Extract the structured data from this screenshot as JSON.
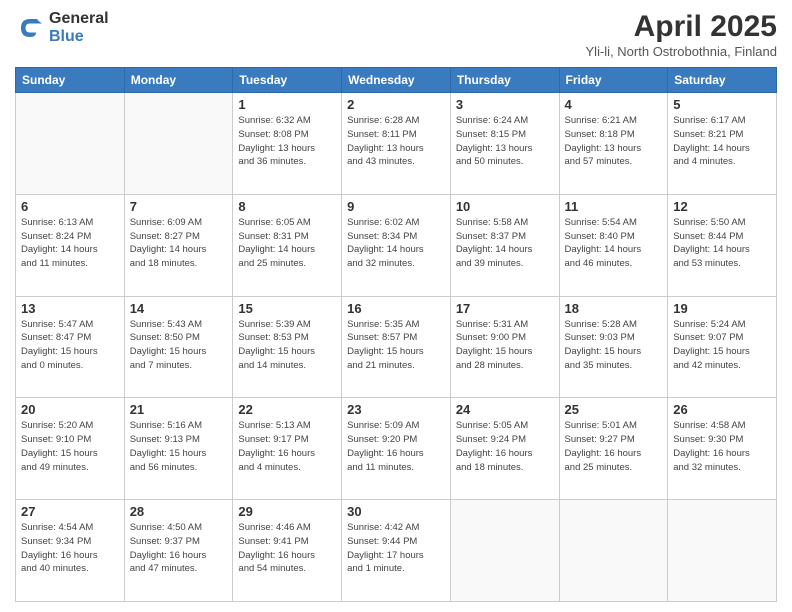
{
  "header": {
    "logo_general": "General",
    "logo_blue": "Blue",
    "title": "April 2025",
    "subtitle": "Yli-li, North Ostrobothnia, Finland"
  },
  "days_of_week": [
    "Sunday",
    "Monday",
    "Tuesday",
    "Wednesday",
    "Thursday",
    "Friday",
    "Saturday"
  ],
  "weeks": [
    [
      {
        "day": "",
        "info": ""
      },
      {
        "day": "",
        "info": ""
      },
      {
        "day": "1",
        "info": "Sunrise: 6:32 AM\nSunset: 8:08 PM\nDaylight: 13 hours\nand 36 minutes."
      },
      {
        "day": "2",
        "info": "Sunrise: 6:28 AM\nSunset: 8:11 PM\nDaylight: 13 hours\nand 43 minutes."
      },
      {
        "day": "3",
        "info": "Sunrise: 6:24 AM\nSunset: 8:15 PM\nDaylight: 13 hours\nand 50 minutes."
      },
      {
        "day": "4",
        "info": "Sunrise: 6:21 AM\nSunset: 8:18 PM\nDaylight: 13 hours\nand 57 minutes."
      },
      {
        "day": "5",
        "info": "Sunrise: 6:17 AM\nSunset: 8:21 PM\nDaylight: 14 hours\nand 4 minutes."
      }
    ],
    [
      {
        "day": "6",
        "info": "Sunrise: 6:13 AM\nSunset: 8:24 PM\nDaylight: 14 hours\nand 11 minutes."
      },
      {
        "day": "7",
        "info": "Sunrise: 6:09 AM\nSunset: 8:27 PM\nDaylight: 14 hours\nand 18 minutes."
      },
      {
        "day": "8",
        "info": "Sunrise: 6:05 AM\nSunset: 8:31 PM\nDaylight: 14 hours\nand 25 minutes."
      },
      {
        "day": "9",
        "info": "Sunrise: 6:02 AM\nSunset: 8:34 PM\nDaylight: 14 hours\nand 32 minutes."
      },
      {
        "day": "10",
        "info": "Sunrise: 5:58 AM\nSunset: 8:37 PM\nDaylight: 14 hours\nand 39 minutes."
      },
      {
        "day": "11",
        "info": "Sunrise: 5:54 AM\nSunset: 8:40 PM\nDaylight: 14 hours\nand 46 minutes."
      },
      {
        "day": "12",
        "info": "Sunrise: 5:50 AM\nSunset: 8:44 PM\nDaylight: 14 hours\nand 53 minutes."
      }
    ],
    [
      {
        "day": "13",
        "info": "Sunrise: 5:47 AM\nSunset: 8:47 PM\nDaylight: 15 hours\nand 0 minutes."
      },
      {
        "day": "14",
        "info": "Sunrise: 5:43 AM\nSunset: 8:50 PM\nDaylight: 15 hours\nand 7 minutes."
      },
      {
        "day": "15",
        "info": "Sunrise: 5:39 AM\nSunset: 8:53 PM\nDaylight: 15 hours\nand 14 minutes."
      },
      {
        "day": "16",
        "info": "Sunrise: 5:35 AM\nSunset: 8:57 PM\nDaylight: 15 hours\nand 21 minutes."
      },
      {
        "day": "17",
        "info": "Sunrise: 5:31 AM\nSunset: 9:00 PM\nDaylight: 15 hours\nand 28 minutes."
      },
      {
        "day": "18",
        "info": "Sunrise: 5:28 AM\nSunset: 9:03 PM\nDaylight: 15 hours\nand 35 minutes."
      },
      {
        "day": "19",
        "info": "Sunrise: 5:24 AM\nSunset: 9:07 PM\nDaylight: 15 hours\nand 42 minutes."
      }
    ],
    [
      {
        "day": "20",
        "info": "Sunrise: 5:20 AM\nSunset: 9:10 PM\nDaylight: 15 hours\nand 49 minutes."
      },
      {
        "day": "21",
        "info": "Sunrise: 5:16 AM\nSunset: 9:13 PM\nDaylight: 15 hours\nand 56 minutes."
      },
      {
        "day": "22",
        "info": "Sunrise: 5:13 AM\nSunset: 9:17 PM\nDaylight: 16 hours\nand 4 minutes."
      },
      {
        "day": "23",
        "info": "Sunrise: 5:09 AM\nSunset: 9:20 PM\nDaylight: 16 hours\nand 11 minutes."
      },
      {
        "day": "24",
        "info": "Sunrise: 5:05 AM\nSunset: 9:24 PM\nDaylight: 16 hours\nand 18 minutes."
      },
      {
        "day": "25",
        "info": "Sunrise: 5:01 AM\nSunset: 9:27 PM\nDaylight: 16 hours\nand 25 minutes."
      },
      {
        "day": "26",
        "info": "Sunrise: 4:58 AM\nSunset: 9:30 PM\nDaylight: 16 hours\nand 32 minutes."
      }
    ],
    [
      {
        "day": "27",
        "info": "Sunrise: 4:54 AM\nSunset: 9:34 PM\nDaylight: 16 hours\nand 40 minutes."
      },
      {
        "day": "28",
        "info": "Sunrise: 4:50 AM\nSunset: 9:37 PM\nDaylight: 16 hours\nand 47 minutes."
      },
      {
        "day": "29",
        "info": "Sunrise: 4:46 AM\nSunset: 9:41 PM\nDaylight: 16 hours\nand 54 minutes."
      },
      {
        "day": "30",
        "info": "Sunrise: 4:42 AM\nSunset: 9:44 PM\nDaylight: 17 hours\nand 1 minute."
      },
      {
        "day": "",
        "info": ""
      },
      {
        "day": "",
        "info": ""
      },
      {
        "day": "",
        "info": ""
      }
    ]
  ]
}
